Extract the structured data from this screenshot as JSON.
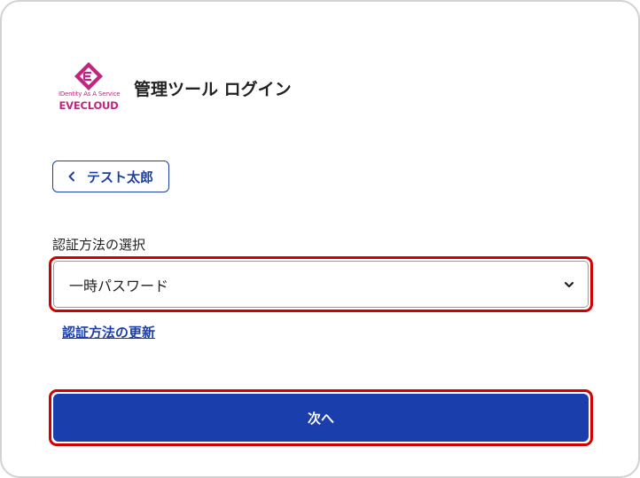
{
  "header": {
    "logo_tagline": "IDentity As A Service",
    "logo_brand": "EVECLOUD",
    "title": "管理ツール ログイン"
  },
  "user_button": {
    "label": "テスト太郎"
  },
  "auth_method": {
    "label": "認証方法の選択",
    "selected": "一時パスワード"
  },
  "update_link": "認証方法の更新",
  "next_button": "次へ",
  "colors": {
    "brand": "#c0267f",
    "primary": "#1a3fad",
    "highlight": "#d20000"
  },
  "icons": [
    "eve-logo-icon",
    "chevron-left-icon",
    "chevron-down-icon"
  ]
}
